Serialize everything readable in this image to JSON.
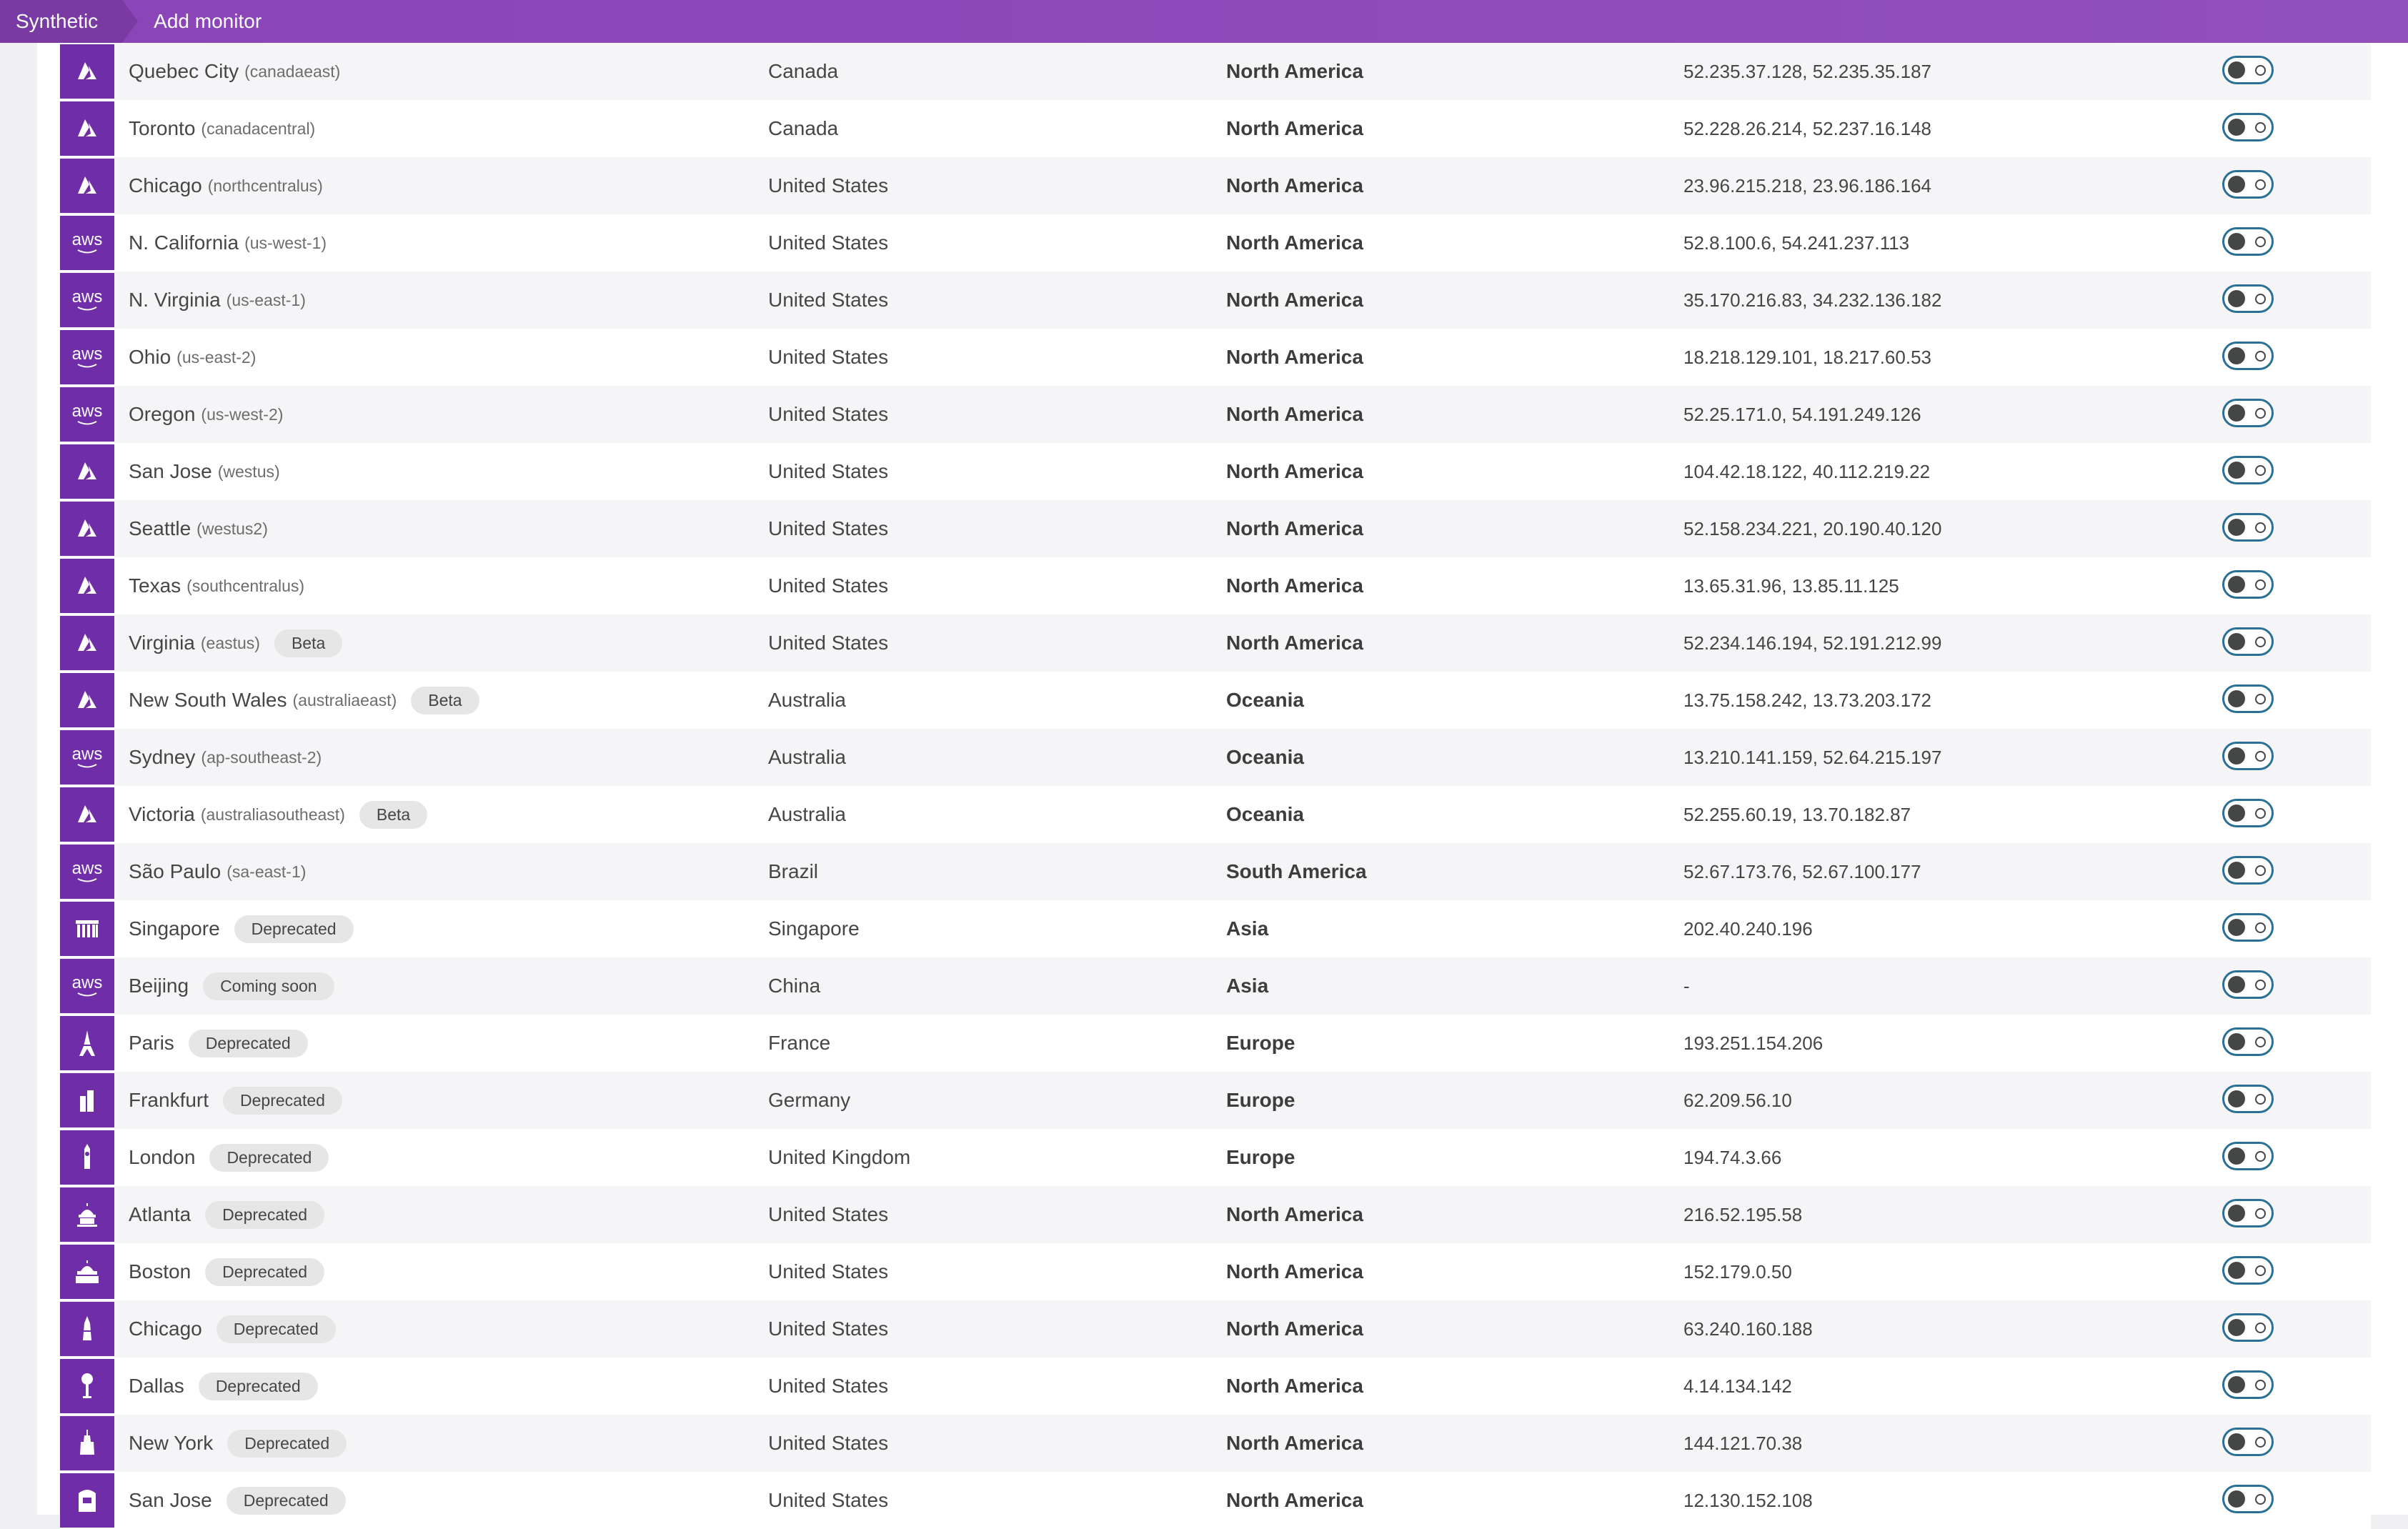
{
  "breadcrumb": {
    "root": "Synthetic",
    "current": "Add monitor"
  },
  "icons": {
    "azure": "azure-icon",
    "aws": "aws-icon",
    "singapore": "singapore-landmark-icon",
    "beijing": "aws-icon",
    "paris": "eiffel-tower-icon",
    "frankfurt": "frankfurt-skyline-icon",
    "london": "big-ben-icon",
    "atlanta": "capitol-icon",
    "boston": "state-house-icon",
    "chicago": "chicago-tower-icon",
    "dallas": "reunion-tower-icon",
    "new_york": "empire-state-icon",
    "san_jose": "san-jose-icon"
  },
  "aws_label": "aws",
  "colors": {
    "header": "#8a45b8",
    "icon_bg": "#6f2da8",
    "toggle_border": "#2a6f97"
  },
  "locations": [
    {
      "icon": "azure",
      "city": "Quebec City",
      "code": "(canadaeast)",
      "badge": "",
      "country": "Canada",
      "continent": "North America",
      "ips": "52.235.37.128, 52.235.35.187",
      "enabled": false
    },
    {
      "icon": "azure",
      "city": "Toronto",
      "code": "(canadacentral)",
      "badge": "",
      "country": "Canada",
      "continent": "North America",
      "ips": "52.228.26.214, 52.237.16.148",
      "enabled": false
    },
    {
      "icon": "azure",
      "city": "Chicago",
      "code": "(northcentralus)",
      "badge": "",
      "country": "United States",
      "continent": "North America",
      "ips": "23.96.215.218, 23.96.186.164",
      "enabled": false
    },
    {
      "icon": "aws",
      "city": "N. California",
      "code": "(us-west-1)",
      "badge": "",
      "country": "United States",
      "continent": "North America",
      "ips": "52.8.100.6, 54.241.237.113",
      "enabled": false
    },
    {
      "icon": "aws",
      "city": "N. Virginia",
      "code": "(us-east-1)",
      "badge": "",
      "country": "United States",
      "continent": "North America",
      "ips": "35.170.216.83, 34.232.136.182",
      "enabled": false
    },
    {
      "icon": "aws",
      "city": "Ohio",
      "code": "(us-east-2)",
      "badge": "",
      "country": "United States",
      "continent": "North America",
      "ips": "18.218.129.101, 18.217.60.53",
      "enabled": false
    },
    {
      "icon": "aws",
      "city": "Oregon",
      "code": "(us-west-2)",
      "badge": "",
      "country": "United States",
      "continent": "North America",
      "ips": "52.25.171.0, 54.191.249.126",
      "enabled": false
    },
    {
      "icon": "azure",
      "city": "San Jose",
      "code": "(westus)",
      "badge": "",
      "country": "United States",
      "continent": "North America",
      "ips": "104.42.18.122, 40.112.219.22",
      "enabled": false
    },
    {
      "icon": "azure",
      "city": "Seattle",
      "code": "(westus2)",
      "badge": "",
      "country": "United States",
      "continent": "North America",
      "ips": "52.158.234.221, 20.190.40.120",
      "enabled": false
    },
    {
      "icon": "azure",
      "city": "Texas",
      "code": "(southcentralus)",
      "badge": "",
      "country": "United States",
      "continent": "North America",
      "ips": "13.65.31.96, 13.85.11.125",
      "enabled": false
    },
    {
      "icon": "azure",
      "city": "Virginia",
      "code": "(eastus)",
      "badge": "Beta",
      "country": "United States",
      "continent": "North America",
      "ips": "52.234.146.194, 52.191.212.99",
      "enabled": false
    },
    {
      "icon": "azure",
      "city": "New South Wales",
      "code": "(australiaeast)",
      "badge": "Beta",
      "country": "Australia",
      "continent": "Oceania",
      "ips": "13.75.158.242, 13.73.203.172",
      "enabled": false
    },
    {
      "icon": "aws",
      "city": "Sydney",
      "code": "(ap-southeast-2)",
      "badge": "",
      "country": "Australia",
      "continent": "Oceania",
      "ips": "13.210.141.159, 52.64.215.197",
      "enabled": false
    },
    {
      "icon": "azure",
      "city": "Victoria",
      "code": "(australiasoutheast)",
      "badge": "Beta",
      "country": "Australia",
      "continent": "Oceania",
      "ips": "52.255.60.19, 13.70.182.87",
      "enabled": false
    },
    {
      "icon": "aws",
      "city": "São Paulo",
      "code": "(sa-east-1)",
      "badge": "",
      "country": "Brazil",
      "continent": "South America",
      "ips": "52.67.173.76, 52.67.100.177",
      "enabled": false
    },
    {
      "icon": "singapore",
      "city": "Singapore",
      "code": "",
      "badge": "Deprecated",
      "country": "Singapore",
      "continent": "Asia",
      "ips": "202.40.240.196",
      "enabled": false
    },
    {
      "icon": "aws",
      "city": "Beijing",
      "code": "",
      "badge": "Coming soon",
      "country": "China",
      "continent": "Asia",
      "ips": "-",
      "enabled": false
    },
    {
      "icon": "paris",
      "city": "Paris",
      "code": "",
      "badge": "Deprecated",
      "country": "France",
      "continent": "Europe",
      "ips": "193.251.154.206",
      "enabled": false
    },
    {
      "icon": "frankfurt",
      "city": "Frankfurt",
      "code": "",
      "badge": "Deprecated",
      "country": "Germany",
      "continent": "Europe",
      "ips": "62.209.56.10",
      "enabled": false
    },
    {
      "icon": "london",
      "city": "London",
      "code": "",
      "badge": "Deprecated",
      "country": "United Kingdom",
      "continent": "Europe",
      "ips": "194.74.3.66",
      "enabled": false
    },
    {
      "icon": "atlanta",
      "city": "Atlanta",
      "code": "",
      "badge": "Deprecated",
      "country": "United States",
      "continent": "North America",
      "ips": "216.52.195.58",
      "enabled": false
    },
    {
      "icon": "boston",
      "city": "Boston",
      "code": "",
      "badge": "Deprecated",
      "country": "United States",
      "continent": "North America",
      "ips": "152.179.0.50",
      "enabled": false
    },
    {
      "icon": "chicago",
      "city": "Chicago",
      "code": "",
      "badge": "Deprecated",
      "country": "United States",
      "continent": "North America",
      "ips": "63.240.160.188",
      "enabled": false
    },
    {
      "icon": "dallas",
      "city": "Dallas",
      "code": "",
      "badge": "Deprecated",
      "country": "United States",
      "continent": "North America",
      "ips": "4.14.134.142",
      "enabled": false
    },
    {
      "icon": "new_york",
      "city": "New York",
      "code": "",
      "badge": "Deprecated",
      "country": "United States",
      "continent": "North America",
      "ips": "144.121.70.38",
      "enabled": false
    },
    {
      "icon": "san_jose",
      "city": "San Jose",
      "code": "",
      "badge": "Deprecated",
      "country": "United States",
      "continent": "North America",
      "ips": "12.130.152.108",
      "enabled": false
    }
  ]
}
